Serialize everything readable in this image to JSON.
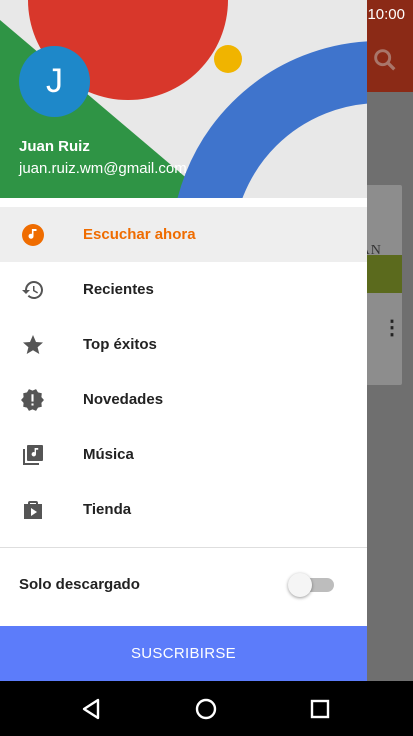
{
  "status_bar": {
    "time": "10:00",
    "icons": [
      "signal-icon",
      "battery-icon"
    ]
  },
  "background_app": {
    "toolbar_color": "#8b2a16",
    "icons": [
      "search-icon",
      "more-vert-icon"
    ],
    "card_text": "IAN"
  },
  "drawer": {
    "account": {
      "avatar_letter": "J",
      "name": "Juan Ruiz",
      "email": "juan.ruiz.wm@gmail.com"
    },
    "menu": [
      {
        "label": "Escuchar ahora",
        "icon": "listen-now-icon",
        "active": true
      },
      {
        "label": "Recientes",
        "icon": "history-icon",
        "active": false
      },
      {
        "label": "Top éxitos",
        "icon": "star-icon",
        "active": false
      },
      {
        "label": "Novedades",
        "icon": "new-releases-icon",
        "active": false
      },
      {
        "label": "Música",
        "icon": "music-library-icon",
        "active": false
      },
      {
        "label": "Tienda",
        "icon": "store-icon",
        "active": false
      }
    ],
    "offline_toggle": {
      "label": "Solo descargado",
      "on": false
    },
    "subscribe_label": "SUSCRIBIRSE"
  },
  "nav_bar": {
    "buttons": [
      "back-icon",
      "home-icon",
      "recents-icon"
    ]
  },
  "colors": {
    "accent": "#ef6c00",
    "subscribe": "#5c7cfa",
    "avatar": "#1e88c9"
  }
}
